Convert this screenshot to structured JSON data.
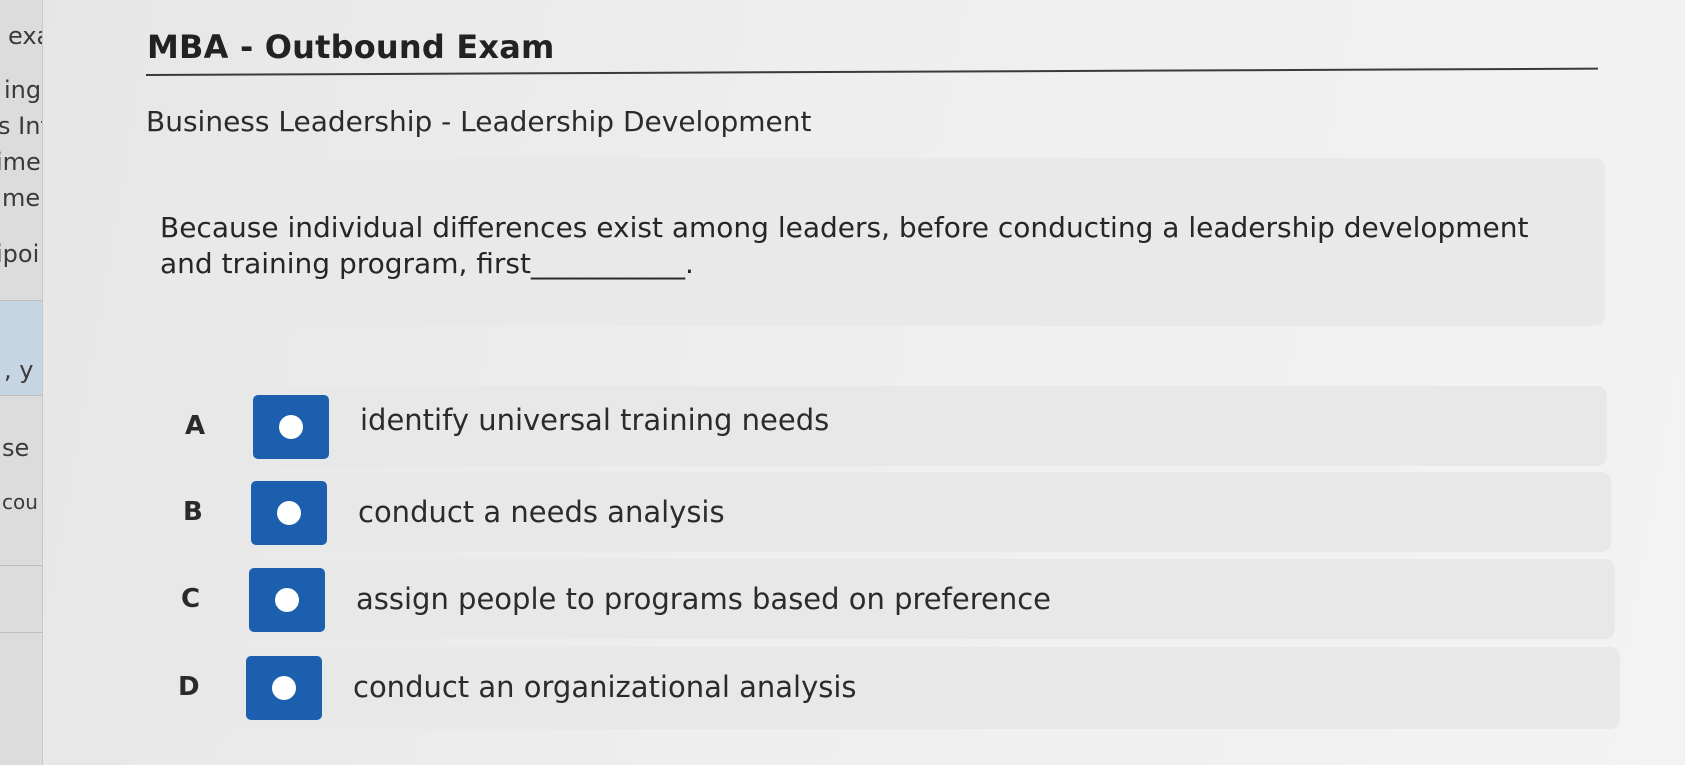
{
  "sidebar": {
    "fragments": [
      "exa",
      "ing",
      "s Int",
      "ime",
      "mer",
      "ipoi",
      ", y",
      "se",
      "cou"
    ]
  },
  "exam": {
    "title": "MBA - Outbound Exam",
    "category": "Business Leadership - Leadership Development"
  },
  "question": {
    "text": "Because individual differences exist among leaders, before conducting a leadership development and training program, first___________."
  },
  "options": [
    {
      "letter": "A",
      "text": "identify universal training needs"
    },
    {
      "letter": "B",
      "text": "conduct a needs analysis"
    },
    {
      "letter": "C",
      "text": "assign people to programs based on preference"
    },
    {
      "letter": "D",
      "text": "conduct an organizational analysis"
    }
  ],
  "colors": {
    "radio_fill": "#1c5fae",
    "radio_dot": "#ffffff",
    "option_bg": "#e8e8e8",
    "sidebar_highlight": "#c6d5e3"
  }
}
